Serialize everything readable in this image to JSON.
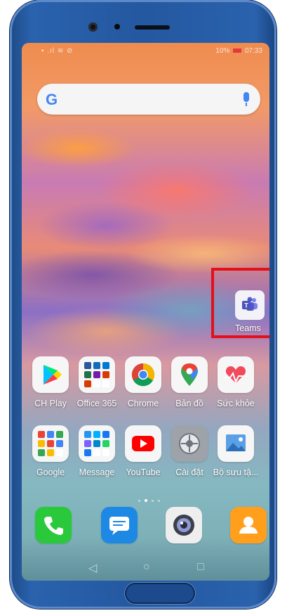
{
  "status_bar": {
    "left": "▪ .ıl ≋ ⊘",
    "battery": "10%",
    "time": "07:33"
  },
  "search": {
    "logo": "G"
  },
  "highlight": {
    "app": {
      "label": "Teams",
      "icon": "teams-icon"
    }
  },
  "apps_row1": [
    {
      "label": "CH Play",
      "icon": "play-store-icon"
    },
    {
      "label": "Office 365",
      "icon": "office-folder-icon"
    },
    {
      "label": "Chrome",
      "icon": "chrome-icon"
    },
    {
      "label": "Bản đồ",
      "icon": "maps-icon"
    },
    {
      "label": "Sức khỏe",
      "icon": "health-icon"
    }
  ],
  "apps_row2": [
    {
      "label": "Google",
      "icon": "google-folder-icon"
    },
    {
      "label": "Message",
      "icon": "message-folder-icon"
    },
    {
      "label": "YouTube",
      "icon": "youtube-icon"
    },
    {
      "label": "Cài đặt",
      "icon": "settings-icon"
    },
    {
      "label": "Bộ sưu tậ...",
      "icon": "gallery-icon"
    }
  ],
  "dock": [
    {
      "icon": "phone-icon"
    },
    {
      "icon": "messages-icon"
    },
    {
      "icon": "camera-icon"
    },
    {
      "icon": "contacts-icon"
    }
  ],
  "nav": {
    "back": "◁",
    "home": "○",
    "recents": "□"
  }
}
